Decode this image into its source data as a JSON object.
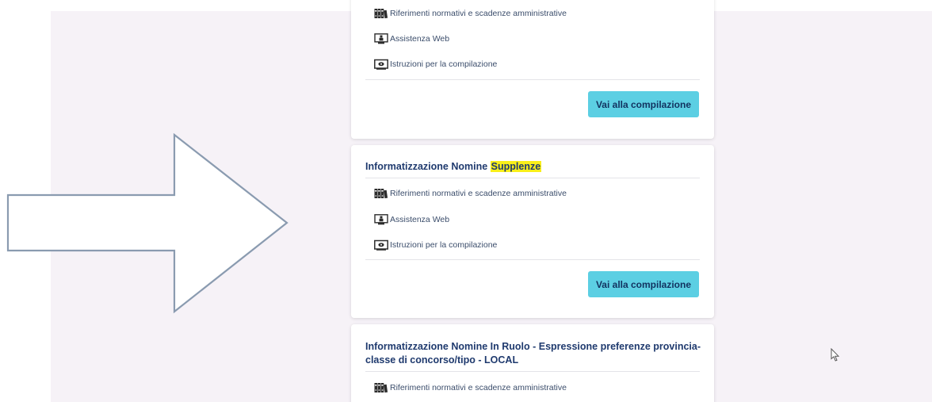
{
  "cards": [
    {
      "title": "",
      "highlight": "",
      "links": [
        {
          "label": "Riferimenti normativi e scadenze amministrative",
          "icon": "binders-icon"
        },
        {
          "label": "Assistenza Web",
          "icon": "computer-support-icon"
        },
        {
          "label": "Istruzioni per la compilazione",
          "icon": "monitor-instructions-icon"
        }
      ],
      "button_label": "Vai alla compilazione"
    },
    {
      "title": "Informatizzazione Nomine ",
      "highlight": "Supplenze",
      "links": [
        {
          "label": "Riferimenti normativi e scadenze amministrative",
          "icon": "binders-icon"
        },
        {
          "label": "Assistenza Web",
          "icon": "computer-support-icon"
        },
        {
          "label": "Istruzioni per la compilazione",
          "icon": "monitor-instructions-icon"
        }
      ],
      "button_label": "Vai alla compilazione"
    },
    {
      "title": "Informatizzazione Nomine In Ruolo - Espressione preferenze provincia-classe di concorso/tipo - LOCAL",
      "highlight": "",
      "links": [
        {
          "label": "Riferimenti normativi e scadenze amministrative",
          "icon": "binders-icon"
        }
      ]
    }
  ],
  "colors": {
    "page_background": "#f6f2f7",
    "card_title": "#1f3a6e",
    "button": "#5ccfe3",
    "highlight": "#f9ef1a",
    "arrow_stroke": "#8a9bb0"
  }
}
